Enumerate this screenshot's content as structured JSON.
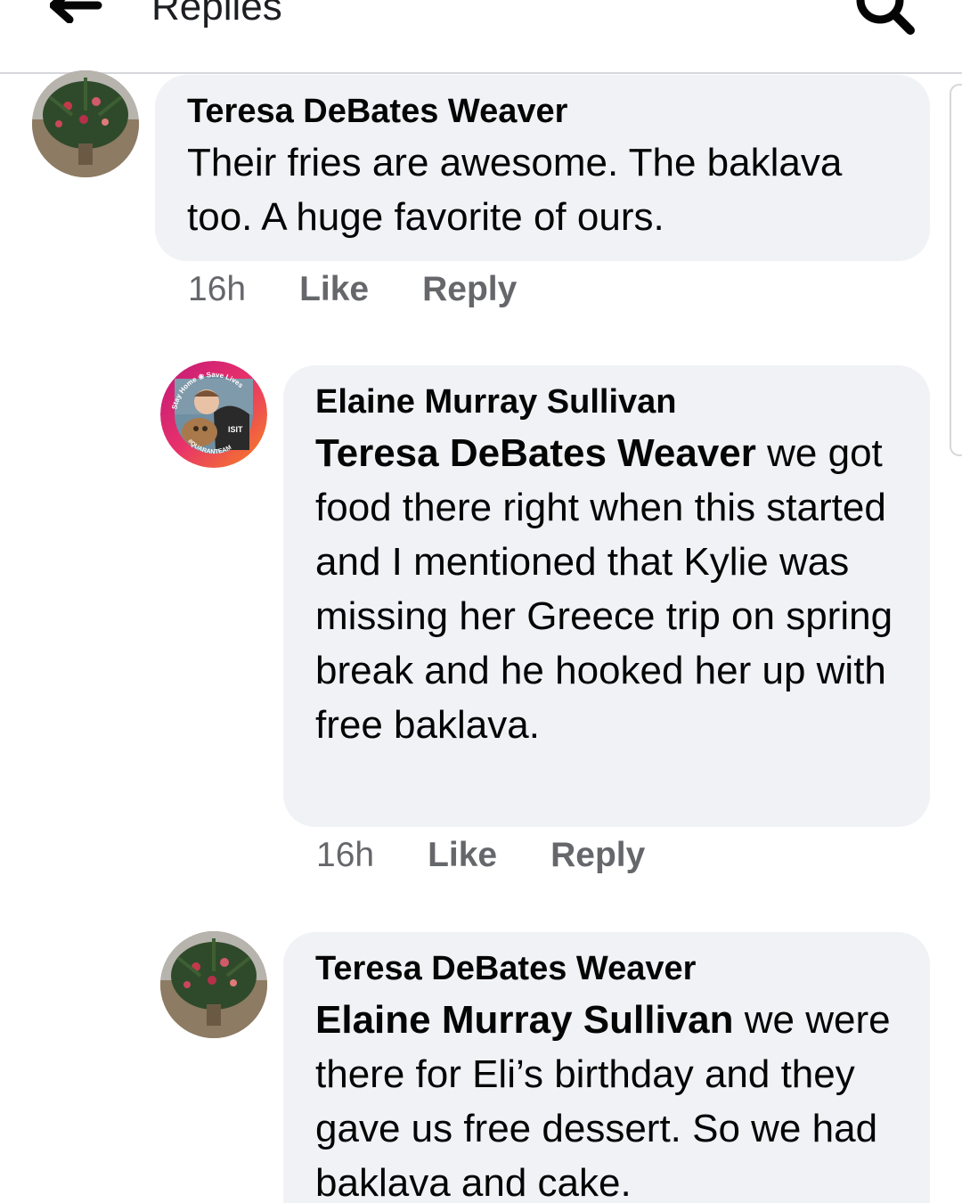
{
  "header": {
    "title": "Replies"
  },
  "comments": [
    {
      "author": "Teresa DeBates Weaver",
      "mention": "",
      "text": "Their fries are awesome. The baklava too. A huge favorite of ours.",
      "time": "16h",
      "like_label": "Like",
      "reply_label": "Reply"
    },
    {
      "author": "Elaine Murray Sullivan",
      "mention": "Teresa DeBates Weaver",
      "text": " we got food there right when this started and I mentioned that Kylie was missing her Greece trip on spring break and he hooked her up with free baklava.",
      "time": "16h",
      "like_label": "Like",
      "reply_label": "Reply",
      "avatar_badge": {
        "top_text": "Stay Home ❀ Save Lives",
        "bottom_text": "#QUARANTEAM",
        "shirt_text": "ISIT"
      }
    },
    {
      "author": "Teresa DeBates Weaver",
      "mention": "Elaine Murray Sullivan",
      "text": " we were there for Eli’s birthday and they gave us free dessert. So we had baklava and cake.",
      "time": "",
      "like_label": "",
      "reply_label": ""
    }
  ],
  "colors": {
    "bubble": "#f0f2f5",
    "secondary_text": "#65676b",
    "divider": "#d6d7db"
  }
}
